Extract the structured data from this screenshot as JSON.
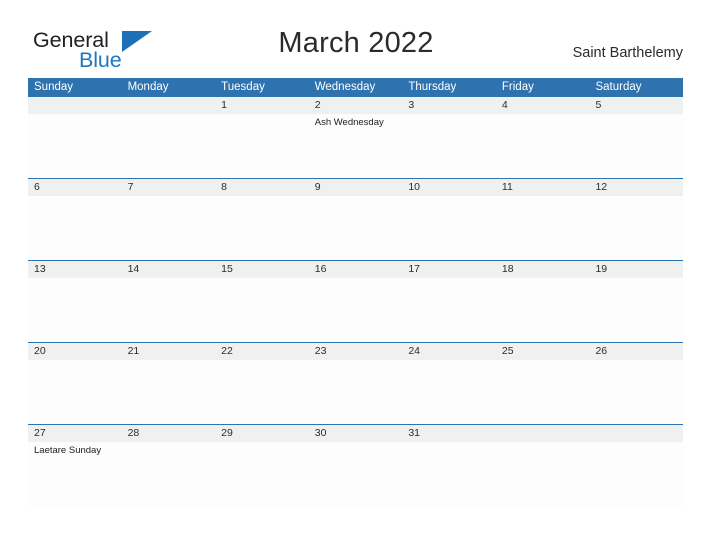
{
  "brand": {
    "name_part1": "General",
    "name_part2": "Blue",
    "flag_color": "#1e6fb5",
    "text_color": "#231f20"
  },
  "header": {
    "title": "March 2022",
    "location": "Saint Barthelemy"
  },
  "theme": {
    "header_blue": "#2e72b0",
    "date_strip_grey": "#eff0f0",
    "cell_white": "#fdfdfd",
    "text_dark": "#2b2b2b"
  },
  "calendar": {
    "day_headers": [
      "Sunday",
      "Monday",
      "Tuesday",
      "Wednesday",
      "Thursday",
      "Friday",
      "Saturday"
    ],
    "weeks": [
      {
        "dates": [
          "",
          "",
          "1",
          "2",
          "3",
          "4",
          "5"
        ],
        "events": [
          "",
          "",
          "",
          "Ash Wednesday",
          "",
          "",
          ""
        ]
      },
      {
        "dates": [
          "6",
          "7",
          "8",
          "9",
          "10",
          "11",
          "12"
        ],
        "events": [
          "",
          "",
          "",
          "",
          "",
          "",
          ""
        ]
      },
      {
        "dates": [
          "13",
          "14",
          "15",
          "16",
          "17",
          "18",
          "19"
        ],
        "events": [
          "",
          "",
          "",
          "",
          "",
          "",
          ""
        ]
      },
      {
        "dates": [
          "20",
          "21",
          "22",
          "23",
          "24",
          "25",
          "26"
        ],
        "events": [
          "",
          "",
          "",
          "",
          "",
          "",
          ""
        ]
      },
      {
        "dates": [
          "27",
          "28",
          "29",
          "30",
          "31",
          "",
          ""
        ],
        "events": [
          "Laetare Sunday",
          "",
          "",
          "",
          "",
          "",
          ""
        ]
      }
    ]
  }
}
